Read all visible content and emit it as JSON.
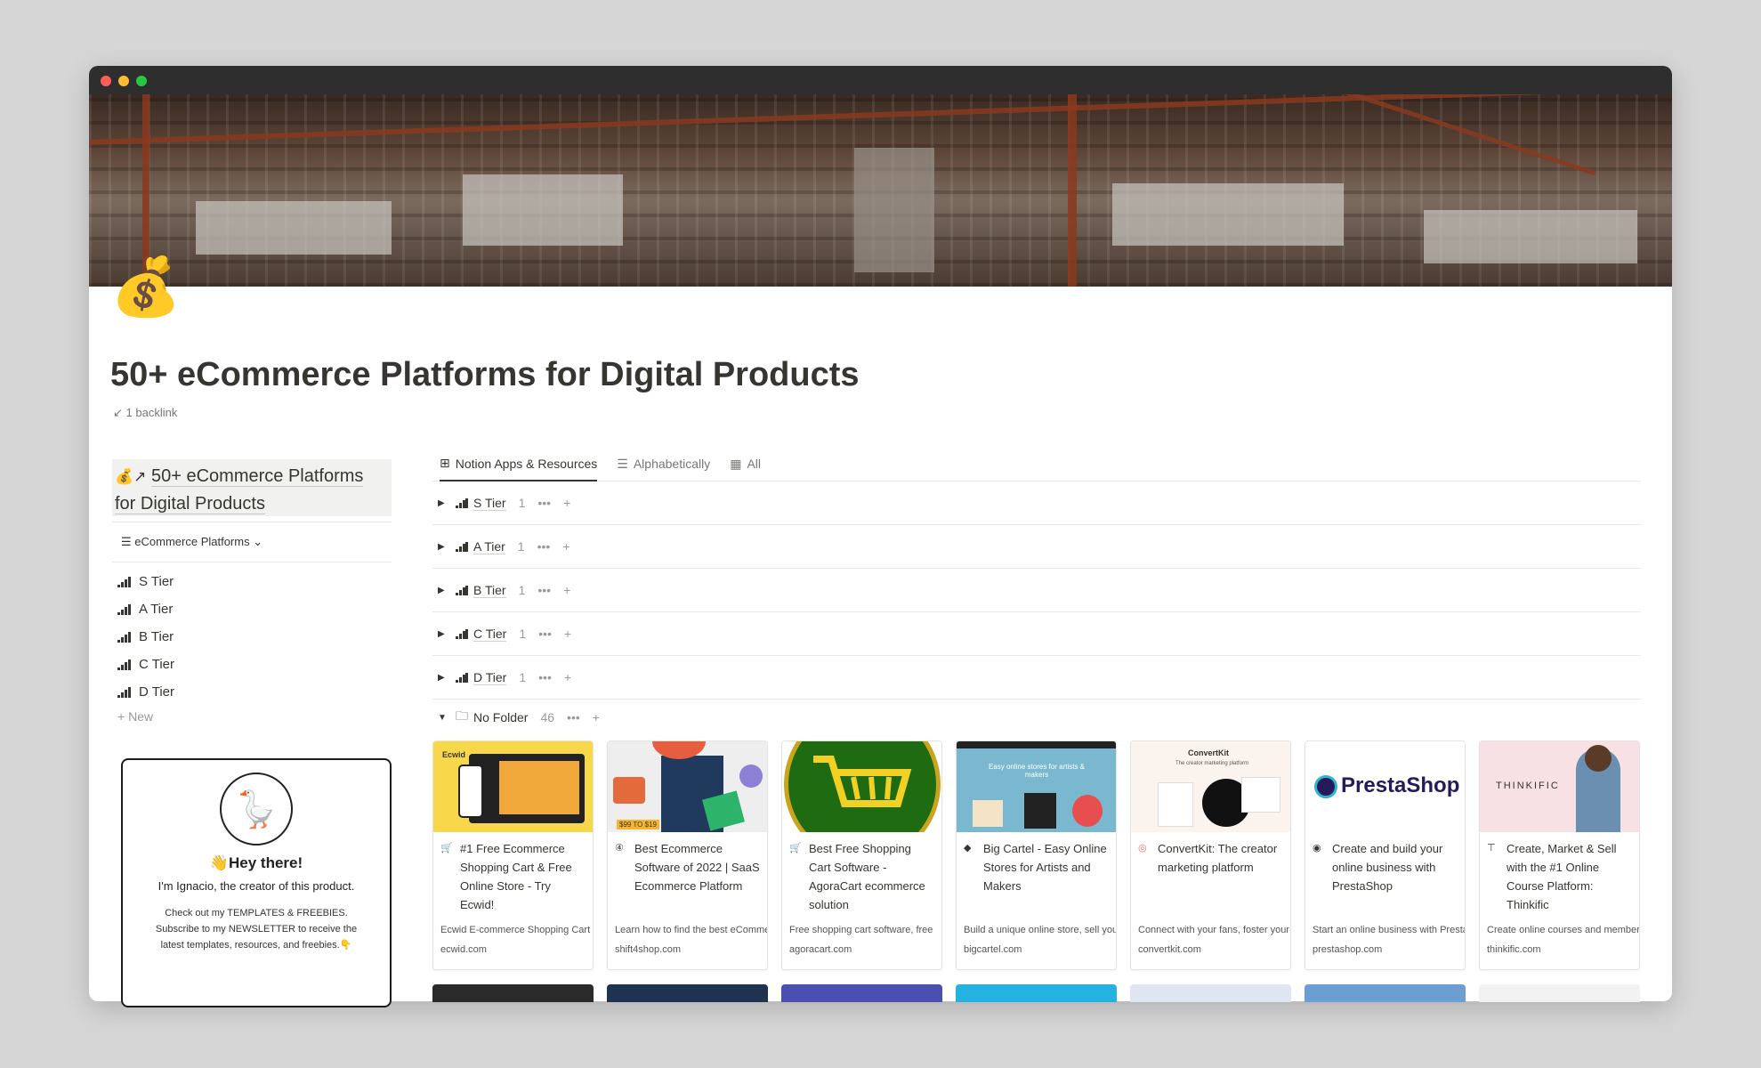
{
  "page": {
    "title": "50+ eCommerce Platforms for Digital Products",
    "backlink": "1 backlink",
    "icon": "money-bag-icon"
  },
  "sidebar": {
    "heading": "50+ eCommerce Platforms for Digital Products",
    "view_label": "eCommerce Platforms",
    "items": [
      {
        "label": "S Tier"
      },
      {
        "label": "A Tier"
      },
      {
        "label": "B Tier"
      },
      {
        "label": "C Tier"
      },
      {
        "label": "D Tier"
      }
    ],
    "new_label": "New"
  },
  "promo": {
    "title": "Hey there!",
    "subtitle": "I'm Ignacio, the creator of this product.",
    "description": "Check out my TEMPLATES & FREEBIES. Subscribe to my NEWSLETTER to receive the latest templates, resources, and freebies."
  },
  "tabs": [
    {
      "label": "Notion Apps & Resources",
      "active": true
    },
    {
      "label": "Alphabetically",
      "active": false
    },
    {
      "label": "All",
      "active": false
    }
  ],
  "groups": [
    {
      "name": "S Tier",
      "count": "1"
    },
    {
      "name": "A Tier",
      "count": "1"
    },
    {
      "name": "B Tier",
      "count": "1"
    },
    {
      "name": "C Tier",
      "count": "1"
    },
    {
      "name": "D Tier",
      "count": "1"
    }
  ],
  "no_folder": {
    "name": "No Folder",
    "count": "46"
  },
  "cards": [
    {
      "title": "#1 Free Ecommerce Shopping Cart & Free Online Store - Try Ecwid!",
      "desc": "Ecwid E-commerce Shopping Cart",
      "url": "ecwid.com",
      "thumb_bg": "#f7d84a"
    },
    {
      "title": "Best Ecommerce Software of 2022 | SaaS Ecommerce Platform",
      "desc": "Learn how to find the best eCommerce",
      "url": "shift4shop.com",
      "thumb_bg": "#eeeeee"
    },
    {
      "title": "Best Free Shopping Cart Software - AgoraCart ecommerce solution",
      "desc": "Free shopping cart software, free",
      "url": "agoracart.com",
      "thumb_bg": "#2e7d1f"
    },
    {
      "title": "Big Cartel - Easy Online Stores for Artists and Makers",
      "desc": "Build a unique online store, sell your",
      "url": "bigcartel.com",
      "thumb_bg": "#7ab8cf"
    },
    {
      "title": "ConvertKit: The creator marketing platform",
      "desc": "Connect with your fans, foster your",
      "url": "convertkit.com",
      "thumb_bg": "#fbf3ee"
    },
    {
      "title": "Create and build your online business with PrestaShop",
      "desc": "Start an online business with PrestaShop",
      "url": "prestashop.com",
      "thumb_bg": "#ffffff"
    },
    {
      "title": "Create, Market & Sell with the #1 Online Course Platform: Thinkific",
      "desc": "Create online courses and membership",
      "url": "thinkific.com",
      "thumb_bg": "#f7e1e4"
    }
  ],
  "card_thumb_text": {
    "ecwid": "Ecwid",
    "shift4": "$99 TO $19",
    "bigcartel": "Easy online stores for artists & makers",
    "convertkit": "ConvertKit",
    "convertkit_tag": "The creator marketing platform",
    "prestashop": "PrestaShop",
    "thinkific": "THINKIFIC"
  }
}
